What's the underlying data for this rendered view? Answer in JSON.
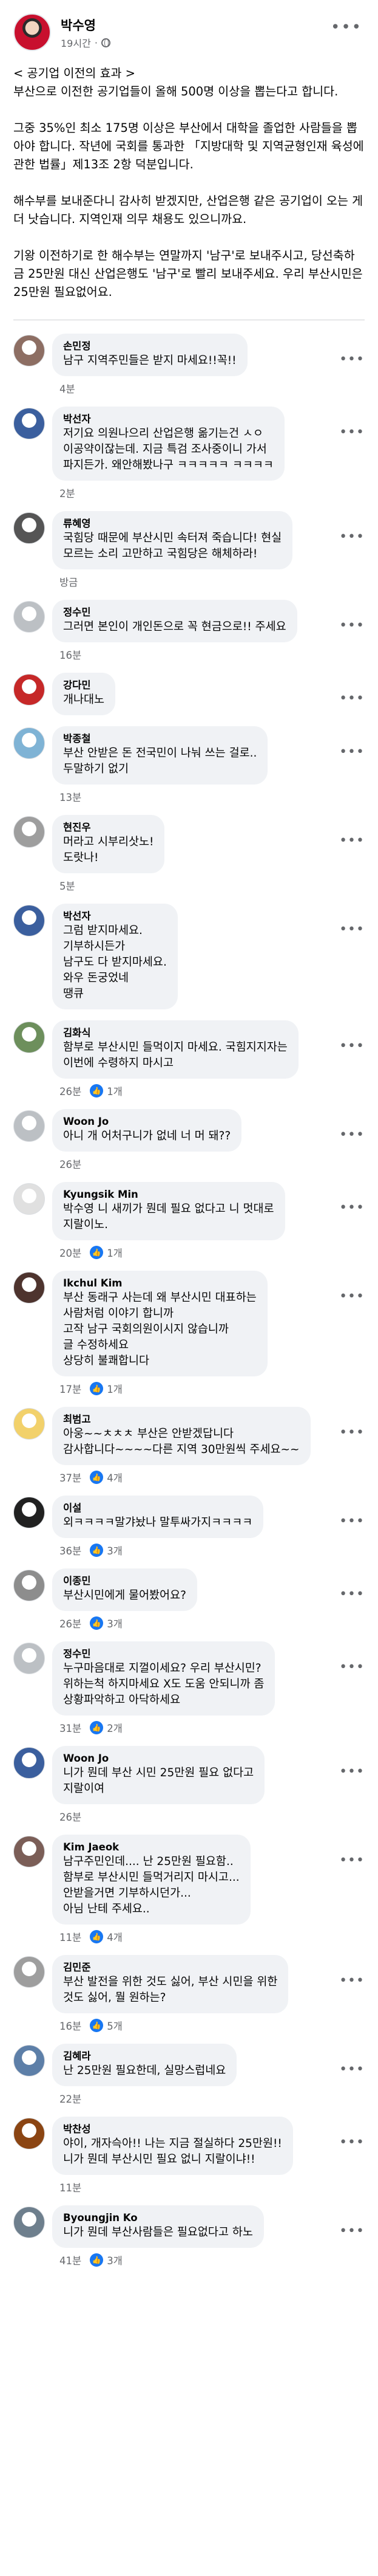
{
  "post": {
    "author": "박수영",
    "time": "19시간",
    "paragraphs": [
      "< 공기업 이전의 효과 >\n부산으로 이전한 공기업들이 올해 500명 이상을 뽑는다고 합니다.",
      "그중 35%인 최소 175명 이상은 부산에서 대학을 졸업한 사람들을 뽑아야 합니다. 작년에 국회를 통과한 「지방대학 및 지역균형인재 육성에 관한 법률」제13조 2항 덕분입니다.",
      "해수부를 보내준다니 감사히 받겠지만, 산업은행 같은 공기업이 오는 게 더 낫습니다. 지역인재 의무 채용도 있으니까요.",
      "기왕 이전하기로 한 해수부는 연말까지 '남구'로 보내주시고, 당선축하금 25만원 대신 산업은행도 '남구'로 빨리 보내주세요. 우리 부산시민은 25만원 필요없어요."
    ]
  },
  "comments": [
    {
      "name": "손민정",
      "text": "남구 지역주민들은 받지 마세요!!꼭!!",
      "time": "4분",
      "likes": "",
      "avatar_color": "#8d6e63"
    },
    {
      "name": "박선자",
      "text": "저기요 의원나으리 산업은행 옮기는건 ㅅㅇ\n이공약이잖는데. 지금 특검 조사중이니 가서\n파지든가. 왜안해봤나구 ㅋㅋㅋㅋㅋ ㅋㅋㅋㅋ",
      "time": "2분",
      "likes": "",
      "avatar_color": "#3b5f9e"
    },
    {
      "name": "류혜영",
      "text": "국힘당 때문에 부산시민 속터져 죽습니다! 현실\n모르는 소리 고만하고 국힘당은 해체하라!",
      "time": "방금",
      "likes": "",
      "avatar_color": "#555555"
    },
    {
      "name": "정수민",
      "text": "그러면 본인이 개인돈으로 꼭 현금으로!! 주세요",
      "time": "16분",
      "likes": "",
      "avatar_color": "#bcc0c4"
    },
    {
      "name": "강다민",
      "text": "개나대노",
      "time": "",
      "likes": "",
      "avatar_color": "#c62828"
    },
    {
      "name": "박종철",
      "text": "부산 안받은 돈 전국민이 나눠 쓰는 걸로..\n두말하기 없기",
      "time": "13분",
      "likes": "",
      "avatar_color": "#7fb3d5"
    },
    {
      "name": "현진우",
      "text": "머라고 시부리삿노!\n도랏나!",
      "time": "5분",
      "likes": "",
      "avatar_color": "#9e9e9e"
    },
    {
      "name": "박선자",
      "text": "그럼 받지마세요.\n기부하시든가\n남구도 다 받지마세요.\n와우 돈궁었네\n땡큐",
      "time": "",
      "likes": "",
      "avatar_color": "#3b5f9e"
    },
    {
      "name": "김화식",
      "text": "함부로 부산시민 들먹이지 마세요. 국힘지지자는\n이번에 수령하지 마시고",
      "time": "26분",
      "likes": "1개",
      "avatar_color": "#6d8f5c"
    },
    {
      "name": "Woon Jo",
      "text": "아니 개 어처구니가 없네 너 머 돼??",
      "time": "26분",
      "likes": "",
      "avatar_color": "#bcc0c4"
    },
    {
      "name": "Kyungsik Min",
      "text": "박수영 니 새끼가 뭔데 필요 없다고 니 멋대로\n지랄이노.",
      "time": "20분",
      "likes": "1개",
      "avatar_color": "#e0e0e0"
    },
    {
      "name": "Ikchul Kim",
      "text": "부산 동래구 사는데 왜 부산시민 대표하는\n사람처럼 이야기 합니까\n고작 남구 국회의원이시지 않습니까\n글 수정하세요\n상당히 불쾌합니다",
      "time": "17분",
      "likes": "1개",
      "avatar_color": "#4e342e"
    },
    {
      "name": "최범고",
      "text": "아웅~~ㅊㅊㅊ 부산은 안받겠답니다\n감사합니다~~~~다른 지역 30만원씩 주세요~~",
      "time": "37분",
      "likes": "4개",
      "avatar_color": "#f2d16b"
    },
    {
      "name": "이설",
      "text": "외ㅋㅋㅋㅋ말갸놨나 말투싸가지ㅋㅋㅋㅋ",
      "time": "36분",
      "likes": "3개",
      "avatar_color": "#212121"
    },
    {
      "name": "이종민",
      "text": "부산시민에게 물어봤어요?",
      "time": "26분",
      "likes": "3개",
      "avatar_color": "#8d8d8d"
    },
    {
      "name": "정수민",
      "text": "누구마음대로 지껄이세요? 우리 부산시민?\n위하는척 하지마세요 X도 도움 안되니까 좀\n상황파악하고 아닥하세요",
      "time": "31분",
      "likes": "2개",
      "avatar_color": "#bcc0c4"
    },
    {
      "name": "Woon Jo",
      "text": "니가 뭔데 부산 시민 25만원 필요 없다고\n지랄이여",
      "time": "26분",
      "likes": "",
      "avatar_color": "#3b5f9e"
    },
    {
      "name": "Kim Jaeok",
      "text": "남구주민인데.... 난 25만원 필요함..\n함부로 부산시민 들먹거리지 마시고...\n안받을거면 기부하시던가...\n아님 난테 주세요..",
      "time": "11분",
      "likes": "4개",
      "avatar_color": "#7b5e57"
    },
    {
      "name": "김민준",
      "text": "부산 발전을 위한 것도 싫어, 부산 시민을 위한\n것도 싫어, 뭘 원하는?",
      "time": "16분",
      "likes": "5개",
      "avatar_color": "#9e9e9e"
    },
    {
      "name": "김혜라",
      "text": "난 25만원 필요한데, 실망스럽네요",
      "time": "22분",
      "likes": "",
      "avatar_color": "#5d7fa8"
    },
    {
      "name": "박찬성",
      "text": "야이, 개자슥아!! 나는 지금 절실하다 25만원!!\n니가 뭔데 부산시민 필요 없니 지랄이냐!!",
      "time": "11분",
      "likes": "",
      "avatar_color": "#8b4513"
    },
    {
      "name": "Byoungjin Ko",
      "text": "니가 뭔데 부산사람들은 필요없다고 하노",
      "time": "41분",
      "likes": "3개",
      "avatar_color": "#6e7f8d"
    }
  ],
  "colors": {
    "accent": "#1877f2",
    "bubble": "#f0f2f5",
    "muted": "#65676b"
  },
  "icons": {
    "more": "more-horizontal-icon",
    "like": "thumbs-up-icon",
    "privacy": "globe-icon"
  }
}
